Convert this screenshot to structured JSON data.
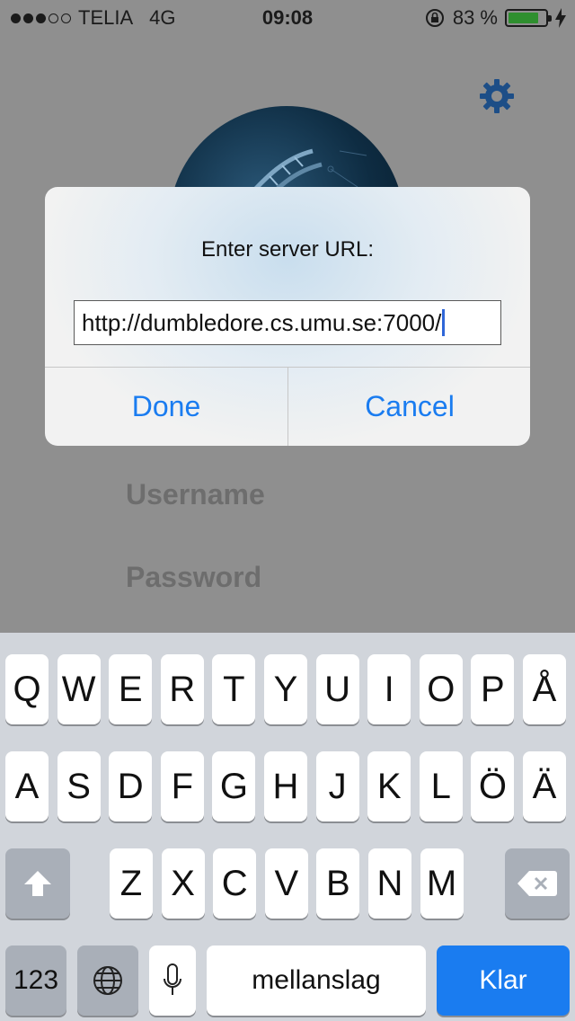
{
  "status": {
    "carrier": "TELIA",
    "network": "4G",
    "time": "09:08",
    "battery_percent": "83 %",
    "battery_level": 0.83
  },
  "background": {
    "username_placeholder": "Username",
    "password_placeholder": "Password"
  },
  "alert": {
    "title": "Enter server URL:",
    "input_value": "http://dumbledore.cs.umu.se:7000/",
    "done_label": "Done",
    "cancel_label": "Cancel",
    "button_color": "#1a7cf0"
  },
  "keyboard": {
    "row1": [
      "Q",
      "W",
      "E",
      "R",
      "T",
      "Y",
      "U",
      "I",
      "O",
      "P",
      "Å"
    ],
    "row2": [
      "A",
      "S",
      "D",
      "F",
      "G",
      "H",
      "J",
      "K",
      "L",
      "Ö",
      "Ä"
    ],
    "row3": [
      "Z",
      "X",
      "C",
      "V",
      "B",
      "N",
      "M"
    ],
    "numbers_label": "123",
    "space_label": "mellanslag",
    "return_label": "Klar",
    "icons": [
      "shift-icon",
      "backspace-icon",
      "globe-icon",
      "microphone-icon"
    ]
  }
}
